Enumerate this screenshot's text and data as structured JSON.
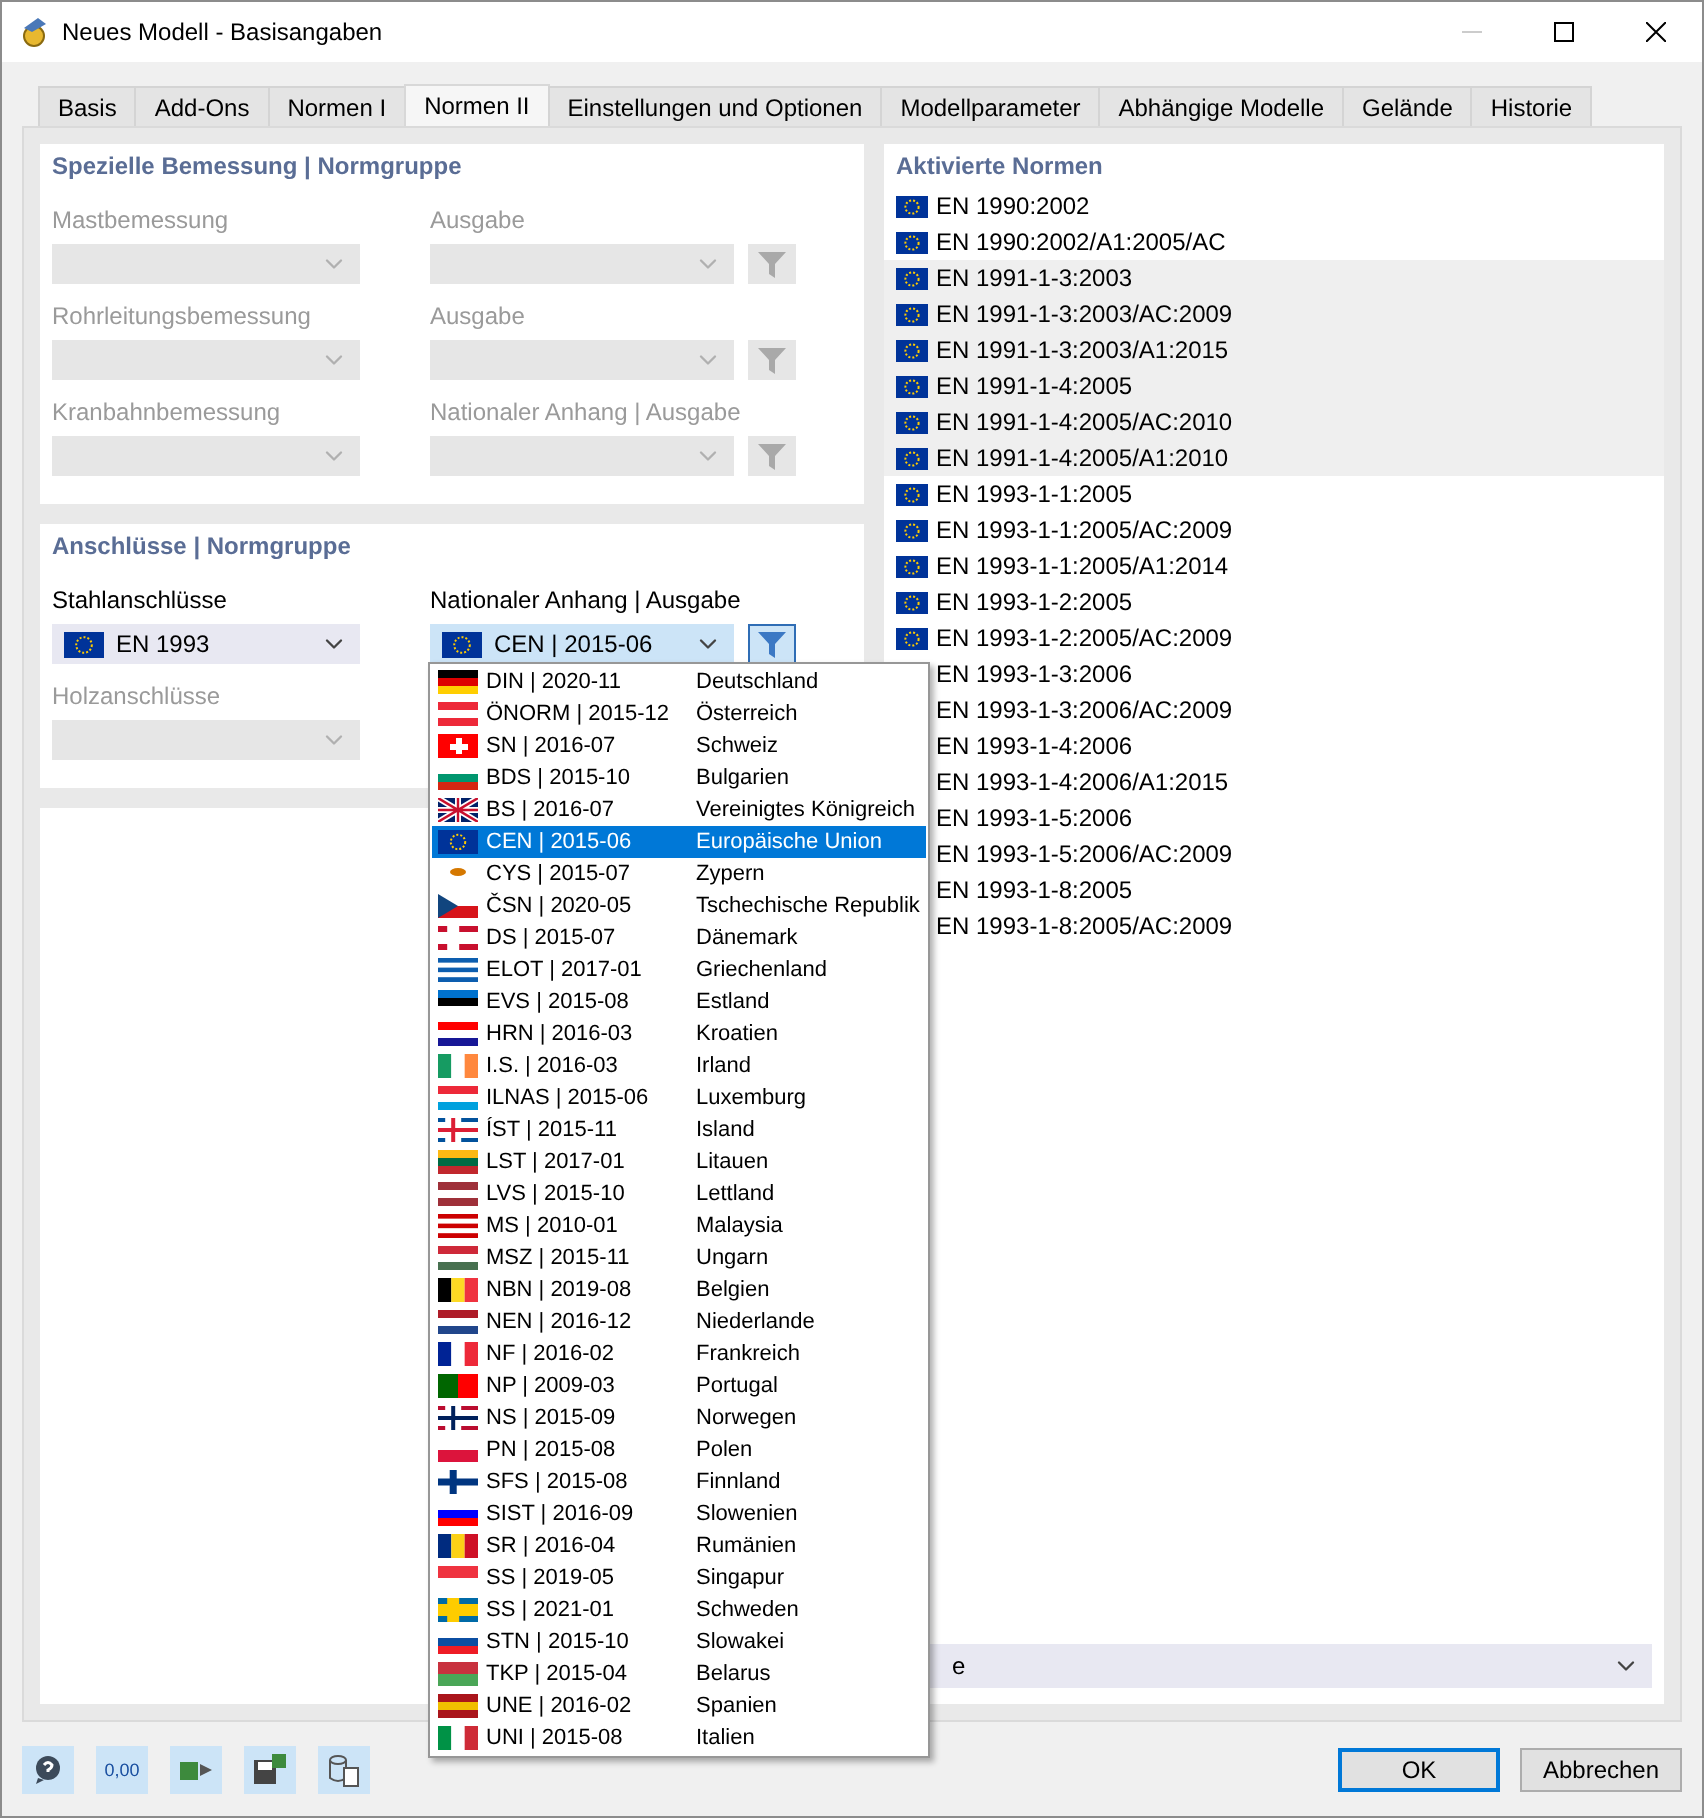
{
  "window": {
    "title": "Neues Modell - Basisangaben"
  },
  "tabs": [
    {
      "label": "Basis",
      "selected": false
    },
    {
      "label": "Add-Ons",
      "selected": false
    },
    {
      "label": "Normen I",
      "selected": false
    },
    {
      "label": "Normen II",
      "selected": true
    },
    {
      "label": "Einstellungen und Optionen",
      "selected": false
    },
    {
      "label": "Modellparameter",
      "selected": false
    },
    {
      "label": "Abhängige Modelle",
      "selected": false
    },
    {
      "label": "Gelände",
      "selected": false
    },
    {
      "label": "Historie",
      "selected": false
    }
  ],
  "sections": [
    {
      "title": "Spezielle Bemessung | Normgruppe",
      "rows": [
        {
          "fields": [
            {
              "label": "Mastbemessung",
              "disabled": true
            },
            {
              "label": "Ausgabe",
              "disabled": true,
              "filter": true
            }
          ]
        },
        {
          "fields": [
            {
              "label": "Rohrleitungsbemessung",
              "disabled": true
            },
            {
              "label": "Ausgabe",
              "disabled": true,
              "filter": true
            }
          ]
        },
        {
          "fields": [
            {
              "label": "Kranbahnbemessung",
              "disabled": true
            },
            {
              "label": "Nationaler Anhang | Ausgabe",
              "disabled": true,
              "filter": true
            }
          ]
        }
      ]
    },
    {
      "title": "Anschlüsse | Normgruppe",
      "rows": [
        {
          "fields": [
            {
              "label": "Stahlanschlüsse",
              "disabled": false,
              "value": "EN 1993"
            },
            {
              "label": "Nationaler Anhang | Ausgabe",
              "disabled": false,
              "open": true,
              "value": "CEN | 2015-06",
              "filter": true
            }
          ]
        },
        {
          "fields": [
            {
              "label": "Holzanschlüsse",
              "disabled": true
            }
          ]
        }
      ]
    }
  ],
  "dropdown": {
    "options": [
      {
        "code": "DIN | 2020-11",
        "country": "Deutschland",
        "selected": false,
        "flag": {
          "kind": "h",
          "stripes": [
            {
              "color": "#000000"
            },
            {
              "color": "#dd0000"
            },
            {
              "color": "#ffce00"
            }
          ]
        }
      },
      {
        "code": "ÖNORM | 2015-12",
        "country": "Österreich",
        "selected": false,
        "flag": {
          "kind": "h",
          "stripes": [
            {
              "color": "#ed2939"
            },
            {
              "color": "#ffffff"
            },
            {
              "color": "#ed2939"
            }
          ]
        }
      },
      {
        "code": "SN | 2016-07",
        "country": "Schweiz",
        "selected": false,
        "flag": {
          "kind": "plus",
          "stripes": [
            {
              "color": "#ff0000"
            },
            {
              "color": "#ffffff"
            }
          ]
        }
      },
      {
        "code": "BDS | 2015-10",
        "country": "Bulgarien",
        "selected": false,
        "flag": {
          "kind": "h",
          "stripes": [
            {
              "color": "#ffffff"
            },
            {
              "color": "#00966e"
            },
            {
              "color": "#d62612"
            }
          ]
        }
      },
      {
        "code": "BS | 2016-07",
        "country": "Vereinigtes Königreich",
        "selected": false,
        "flag": {
          "kind": "uk",
          "stripes": [
            {
              "color": "#012169"
            },
            {
              "color": "#ffffff"
            },
            {
              "color": "#c8102e"
            }
          ]
        }
      },
      {
        "code": "CEN | 2015-06",
        "country": "Europäische Union",
        "selected": true,
        "flag": {
          "kind": "eu",
          "stripes": [
            {
              "color": "#003399"
            },
            {
              "color": "#ffcc00"
            }
          ]
        }
      },
      {
        "code": "CYS | 2015-07",
        "country": "Zypern",
        "selected": false,
        "flag": {
          "kind": "dot",
          "stripes": [
            {
              "color": "#ffffff"
            },
            {
              "color": "#d57800"
            }
          ]
        }
      },
      {
        "code": "ČSN | 2020-05",
        "country": "Tschechische Republik",
        "selected": false,
        "flag": {
          "kind": "tri",
          "stripes": [
            {
              "color": "#ffffff"
            },
            {
              "color": "#d7141a"
            },
            {
              "color": "#11457e"
            }
          ]
        }
      },
      {
        "code": "DS | 2015-07",
        "country": "Dänemark",
        "selected": false,
        "flag": {
          "kind": "cross",
          "stripes": [
            {
              "color": "#c8102e"
            },
            {
              "color": "#ffffff"
            }
          ]
        }
      },
      {
        "code": "ELOT | 2017-01",
        "country": "Griechenland",
        "selected": false,
        "flag": {
          "kind": "h",
          "stripes": [
            {
              "color": "#0d5eaf"
            },
            {
              "color": "#ffffff"
            },
            {
              "color": "#0d5eaf"
            },
            {
              "color": "#ffffff"
            },
            {
              "color": "#0d5eaf"
            }
          ]
        }
      },
      {
        "code": "EVS | 2015-08",
        "country": "Estland",
        "selected": false,
        "flag": {
          "kind": "h",
          "stripes": [
            {
              "color": "#0072ce"
            },
            {
              "color": "#000000"
            },
            {
              "color": "#ffffff"
            }
          ]
        }
      },
      {
        "code": "HRN | 2016-03",
        "country": "Kroatien",
        "selected": false,
        "flag": {
          "kind": "h",
          "stripes": [
            {
              "color": "#ff0000"
            },
            {
              "color": "#ffffff"
            },
            {
              "color": "#171796"
            }
          ]
        }
      },
      {
        "code": "I.S. | 2016-03",
        "country": "Irland",
        "selected": false,
        "flag": {
          "kind": "v",
          "stripes": [
            {
              "color": "#169b62"
            },
            {
              "color": "#ffffff"
            },
            {
              "color": "#ff883e"
            }
          ]
        }
      },
      {
        "code": "ILNAS | 2015-06",
        "country": "Luxemburg",
        "selected": false,
        "flag": {
          "kind": "h",
          "stripes": [
            {
              "color": "#ed2939"
            },
            {
              "color": "#ffffff"
            },
            {
              "color": "#00a1de"
            }
          ]
        }
      },
      {
        "code": "ÍST | 2015-11",
        "country": "Island",
        "selected": false,
        "flag": {
          "kind": "cross",
          "stripes": [
            {
              "color": "#02529c"
            },
            {
              "color": "#ffffff"
            },
            {
              "color": "#dc1e35"
            }
          ]
        }
      },
      {
        "code": "LST | 2017-01",
        "country": "Litauen",
        "selected": false,
        "flag": {
          "kind": "h",
          "stripes": [
            {
              "color": "#fdb913"
            },
            {
              "color": "#006a44"
            },
            {
              "color": "#c1272d"
            }
          ]
        }
      },
      {
        "code": "LVS | 2015-10",
        "country": "Lettland",
        "selected": false,
        "flag": {
          "kind": "h",
          "stripes": [
            {
              "color": "#9e3039"
            },
            {
              "color": "#ffffff"
            },
            {
              "color": "#9e3039"
            }
          ]
        }
      },
      {
        "code": "MS | 2010-01",
        "country": "Malaysia",
        "selected": false,
        "flag": {
          "kind": "h",
          "stripes": [
            {
              "color": "#cc0001"
            },
            {
              "color": "#ffffff"
            },
            {
              "color": "#cc0001"
            },
            {
              "color": "#ffffff"
            },
            {
              "color": "#cc0001"
            }
          ]
        }
      },
      {
        "code": "MSZ | 2015-11",
        "country": "Ungarn",
        "selected": false,
        "flag": {
          "kind": "h",
          "stripes": [
            {
              "color": "#ce2939"
            },
            {
              "color": "#ffffff"
            },
            {
              "color": "#477050"
            }
          ]
        }
      },
      {
        "code": "NBN | 2019-08",
        "country": "Belgien",
        "selected": false,
        "flag": {
          "kind": "v",
          "stripes": [
            {
              "color": "#000000"
            },
            {
              "color": "#fdda24"
            },
            {
              "color": "#ef3340"
            }
          ]
        }
      },
      {
        "code": "NEN | 2016-12",
        "country": "Niederlande",
        "selected": false,
        "flag": {
          "kind": "h",
          "stripes": [
            {
              "color": "#ae1c28"
            },
            {
              "color": "#ffffff"
            },
            {
              "color": "#21468b"
            }
          ]
        }
      },
      {
        "code": "NF | 2016-02",
        "country": "Frankreich",
        "selected": false,
        "flag": {
          "kind": "v",
          "stripes": [
            {
              "color": "#002395"
            },
            {
              "color": "#ffffff"
            },
            {
              "color": "#ed2939"
            }
          ]
        }
      },
      {
        "code": "NP | 2009-03",
        "country": "Portugal",
        "selected": false,
        "flag": {
          "kind": "v",
          "stripes": [
            {
              "color": "#006600"
            },
            {
              "color": "#ff0000"
            }
          ]
        }
      },
      {
        "code": "NS | 2015-09",
        "country": "Norwegen",
        "selected": false,
        "flag": {
          "kind": "cross",
          "stripes": [
            {
              "color": "#ba0c2f"
            },
            {
              "color": "#ffffff"
            },
            {
              "color": "#00205b"
            }
          ]
        }
      },
      {
        "code": "PN | 2015-08",
        "country": "Polen",
        "selected": false,
        "flag": {
          "kind": "h",
          "stripes": [
            {
              "color": "#ffffff"
            },
            {
              "color": "#dc143c"
            }
          ]
        }
      },
      {
        "code": "SFS | 2015-08",
        "country": "Finnland",
        "selected": false,
        "flag": {
          "kind": "cross",
          "stripes": [
            {
              "color": "#ffffff"
            },
            {
              "color": "#003580"
            }
          ]
        }
      },
      {
        "code": "SIST | 2016-09",
        "country": "Slowenien",
        "selected": false,
        "flag": {
          "kind": "h",
          "stripes": [
            {
              "color": "#ffffff"
            },
            {
              "color": "#0000ff"
            },
            {
              "color": "#ff0000"
            }
          ]
        }
      },
      {
        "code": "SR | 2016-04",
        "country": "Rumänien",
        "selected": false,
        "flag": {
          "kind": "v",
          "stripes": [
            {
              "color": "#002b7f"
            },
            {
              "color": "#fcd116"
            },
            {
              "color": "#ce1126"
            }
          ]
        }
      },
      {
        "code": "SS | 2019-05",
        "country": "Singapur",
        "selected": false,
        "flag": {
          "kind": "h",
          "stripes": [
            {
              "color": "#ef3340"
            },
            {
              "color": "#ffffff"
            }
          ]
        }
      },
      {
        "code": "SS | 2021-01",
        "country": "Schweden",
        "selected": false,
        "flag": {
          "kind": "cross",
          "stripes": [
            {
              "color": "#006aa7"
            },
            {
              "color": "#fecc00"
            }
          ]
        }
      },
      {
        "code": "STN | 2015-10",
        "country": "Slowakei",
        "selected": false,
        "flag": {
          "kind": "h",
          "stripes": [
            {
              "color": "#ffffff"
            },
            {
              "color": "#0b4ea2"
            },
            {
              "color": "#ee1c25"
            }
          ]
        }
      },
      {
        "code": "TKP | 2015-04",
        "country": "Belarus",
        "selected": false,
        "flag": {
          "kind": "h",
          "stripes": [
            {
              "color": "#c8313e"
            },
            {
              "color": "#4aa657"
            }
          ]
        }
      },
      {
        "code": "UNE | 2016-02",
        "country": "Spanien",
        "selected": false,
        "flag": {
          "kind": "h",
          "stripes": [
            {
              "color": "#aa151b"
            },
            {
              "color": "#f1bf00"
            },
            {
              "color": "#aa151b"
            }
          ]
        }
      },
      {
        "code": "UNI | 2015-08",
        "country": "Italien",
        "selected": false,
        "flag": {
          "kind": "v",
          "stripes": [
            {
              "color": "#009246"
            },
            {
              "color": "#ffffff"
            },
            {
              "color": "#ce2b37"
            }
          ]
        }
      }
    ]
  },
  "activated": {
    "title": "Aktivierte Normen",
    "items": [
      {
        "label": "EN 1990:2002",
        "shaded": false
      },
      {
        "label": "EN 1990:2002/A1:2005/AC",
        "shaded": false
      },
      {
        "label": "EN 1991-1-3:2003",
        "shaded": true
      },
      {
        "label": "EN 1991-1-3:2003/AC:2009",
        "shaded": true
      },
      {
        "label": "EN 1991-1-3:2003/A1:2015",
        "shaded": true
      },
      {
        "label": "EN 1991-1-4:2005",
        "shaded": true
      },
      {
        "label": "EN 1991-1-4:2005/AC:2010",
        "shaded": true
      },
      {
        "label": "EN 1991-1-4:2005/A1:2010",
        "shaded": true
      },
      {
        "label": "EN 1993-1-1:2005",
        "shaded": false
      },
      {
        "label": "EN 1993-1-1:2005/AC:2009",
        "shaded": false
      },
      {
        "label": "EN 1993-1-1:2005/A1:2014",
        "shaded": false
      },
      {
        "label": "EN 1993-1-2:2005",
        "shaded": false
      },
      {
        "label": "EN 1993-1-2:2005/AC:2009",
        "shaded": false
      },
      {
        "label": "EN 1993-1-3:2006",
        "shaded": false
      },
      {
        "label": "EN 1993-1-3:2006/AC:2009",
        "shaded": false
      },
      {
        "label": "EN 1993-1-4:2006",
        "shaded": false
      },
      {
        "label": "EN 1993-1-4:2006/A1:2015",
        "shaded": false
      },
      {
        "label": "EN 1993-1-5:2006",
        "shaded": false
      },
      {
        "label": "EN 1993-1-5:2006/AC:2009",
        "shaded": false
      },
      {
        "label": "EN 1993-1-8:2005",
        "shaded": false
      },
      {
        "label": "EN 1993-1-8:2005/AC:2009",
        "shaded": false
      }
    ],
    "combo_value": "e"
  },
  "toolbar": {
    "decimals_label": "0,00"
  },
  "buttons": [
    {
      "label": "OK",
      "default": true
    },
    {
      "label": "Abbrechen",
      "default": false
    }
  ]
}
